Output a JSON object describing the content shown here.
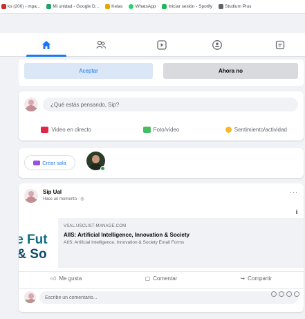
{
  "bookmarks": [
    {
      "label": "ks (200) - mpa...",
      "color": "#c4302b"
    },
    {
      "label": "Mi unidad - Google D...",
      "color": "#1fa463"
    },
    {
      "label": "Kelas",
      "color": "#e8a400"
    },
    {
      "label": "WhatsApp",
      "color": "#25d366"
    },
    {
      "label": "Iniciar sesión - Spotify",
      "color": "#1db954"
    },
    {
      "label": "Studium Plus",
      "color": "#5f6368"
    }
  ],
  "nav": {
    "items": [
      {
        "icon": "home-icon",
        "active": true
      },
      {
        "icon": "friends-icon",
        "active": false
      },
      {
        "icon": "watch-icon",
        "active": false
      },
      {
        "icon": "groups-icon",
        "active": false
      },
      {
        "icon": "gaming-icon",
        "active": false
      }
    ],
    "accent": "#1877f2"
  },
  "consent": {
    "accept": "Aceptar",
    "later": "Ahora no"
  },
  "composer": {
    "placeholder": "¿Qué estás pensando, Sip?",
    "actions": [
      {
        "label": "Video en directo",
        "color": "#e42645"
      },
      {
        "label": "Foto/vídeo",
        "color": "#45bd62"
      },
      {
        "label": "Sentimiento/actividad",
        "color": "#f7b928"
      }
    ]
  },
  "rooms": {
    "create": "Crear sala"
  },
  "post": {
    "author": "Sip Ual",
    "time": "Hace un momento · ",
    "more": "···",
    "banner": {
      "line1": "The Fut",
      "line2": "AI & So"
    },
    "preview": {
      "domain": "VSAL.USCLIST-MANAGE.COM",
      "title": "AIIS: Artificial Intelligence, Innovation & Society",
      "subtitle": "AIIS: Artificial Intelligence, Innovation & Society Email Forms",
      "info": "i"
    },
    "actions": {
      "like": "Me gusta",
      "comment": "Comentar",
      "share": "Compartir"
    },
    "comment_placeholder": "Escribe un comentario..."
  }
}
